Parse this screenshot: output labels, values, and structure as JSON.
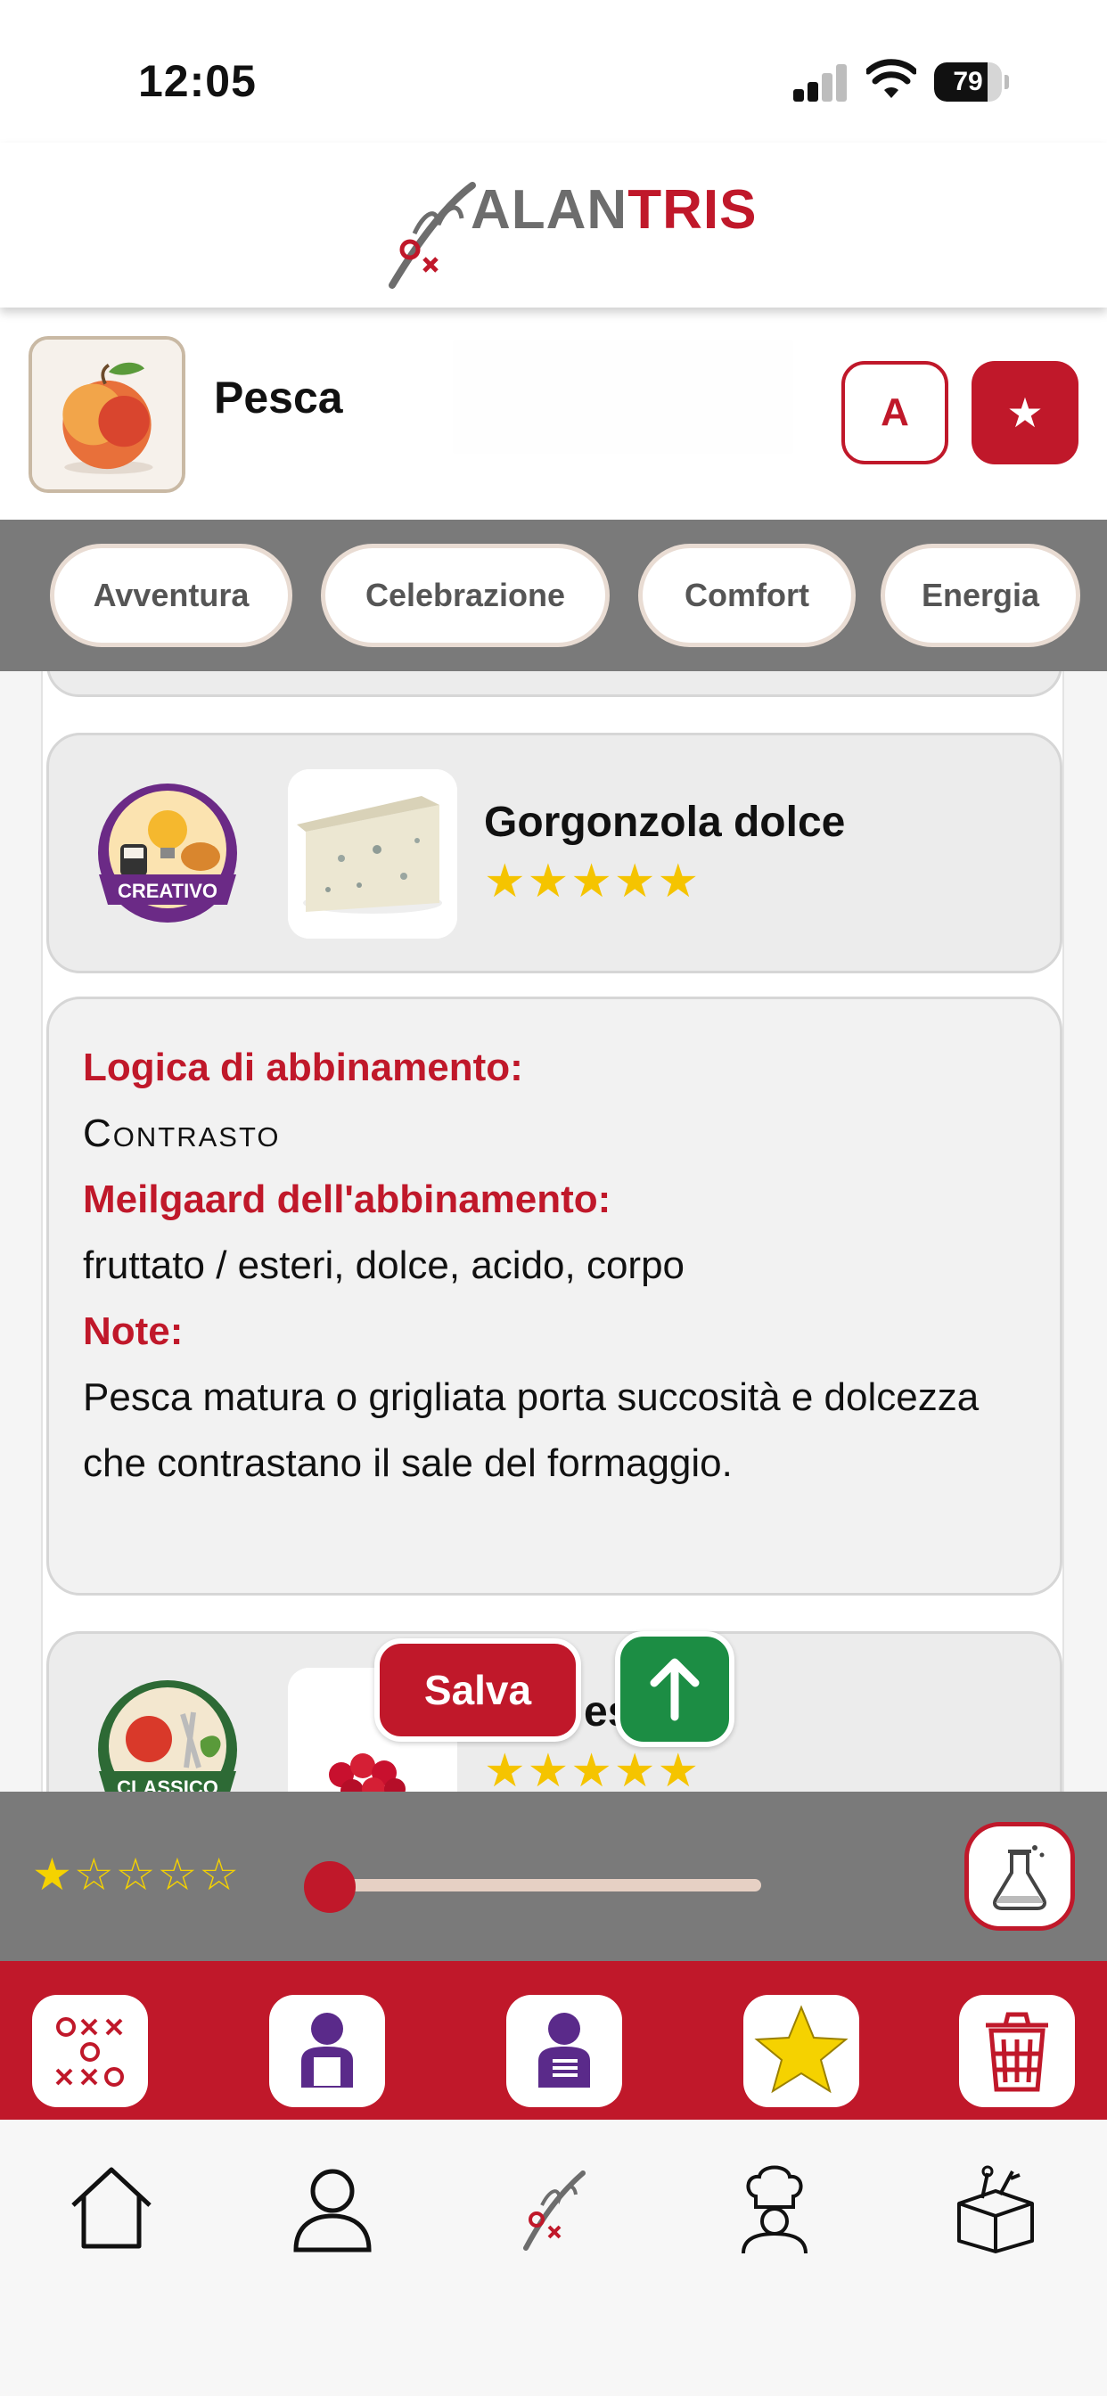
{
  "status_bar": {
    "time": "12:05",
    "battery": "79",
    "battery_level": 0.79
  },
  "header": {
    "logo_prefix": "ALAN",
    "logo_suffix": "TRIS"
  },
  "selected": {
    "title": "Pesca",
    "icon": "peach-image",
    "btn_a": "A",
    "btn_star": "★"
  },
  "moods": [
    "Avventura",
    "Celebrazione",
    "Comfort",
    "Energia"
  ],
  "pairing": {
    "badge": "CREATIVO",
    "title": "Gorgonzola dolce",
    "stars": "★★★★★",
    "rating": 5,
    "logic_label": "Logica di abbinamento:",
    "logic_value": "Contrasto",
    "meilgaard_label": "Meilgaard dell'abbinamento:",
    "meilgaard_value": "fruttato / esteri, dolce, acido, corpo",
    "notes_label": "Note:",
    "notes_value": "Pesca matura o grigliata porta succosità e dolcezza che contrastano il sale del formaggio."
  },
  "next_card": {
    "badge": "CLASSICO",
    "title_visible": "es i",
    "stars": "★★★★★"
  },
  "actions": {
    "save": "Salva",
    "scroll_top": "arrow-up-icon"
  },
  "rating_filter": {
    "stars": "★☆☆☆☆",
    "value": 1,
    "slider_level": 0.0
  },
  "toolbar": [
    "tictactoe-icon",
    "person-card-icon",
    "person-list-icon",
    "star-icon",
    "trash-icon"
  ],
  "tabs": [
    "home-icon",
    "profile-icon",
    "alantris-icon",
    "chef-icon",
    "toolbox-icon"
  ],
  "colors": {
    "brand_red": "#c0182a",
    "green": "#1c8d44",
    "gray_bar": "#7a7a7a",
    "star_yellow": "#f5c400"
  }
}
